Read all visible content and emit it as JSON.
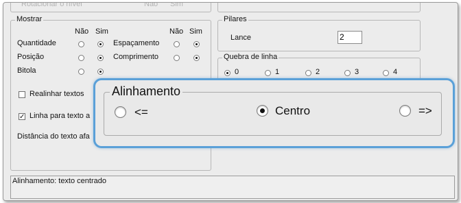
{
  "top_row": {
    "faded_left": "Rotacionar o nível",
    "faded_nao": "Não",
    "faded_sim": "Sim"
  },
  "mostrar": {
    "title": "Mostrar",
    "nao": "Não",
    "sim": "Sim",
    "rows_left": [
      {
        "label": "Quantidade",
        "selected": "sim"
      },
      {
        "label": "Posição",
        "selected": "sim"
      },
      {
        "label": "Bitola",
        "selected": "sim"
      }
    ],
    "rows_right": [
      {
        "label": "Espaçamento",
        "selected": "sim"
      },
      {
        "label": "Comprimento",
        "selected": "sim"
      }
    ],
    "realinhar": "Realinhar textos",
    "linha_para_texto": "Linha para texto a",
    "distancia": "Distância do texto afa"
  },
  "pilares": {
    "title": "Pilares",
    "lance_label": "Lance",
    "lance_value": "2"
  },
  "quebra": {
    "title": "Quebra de linha",
    "options": [
      "0",
      "1",
      "2",
      "3",
      "4"
    ],
    "selected": "0"
  },
  "alinhamento": {
    "title": "Alinhamento",
    "options": [
      "<=",
      "Centro",
      "=>"
    ],
    "selected": "Centro"
  },
  "status": {
    "text": "Alinhamento: texto centrado"
  }
}
